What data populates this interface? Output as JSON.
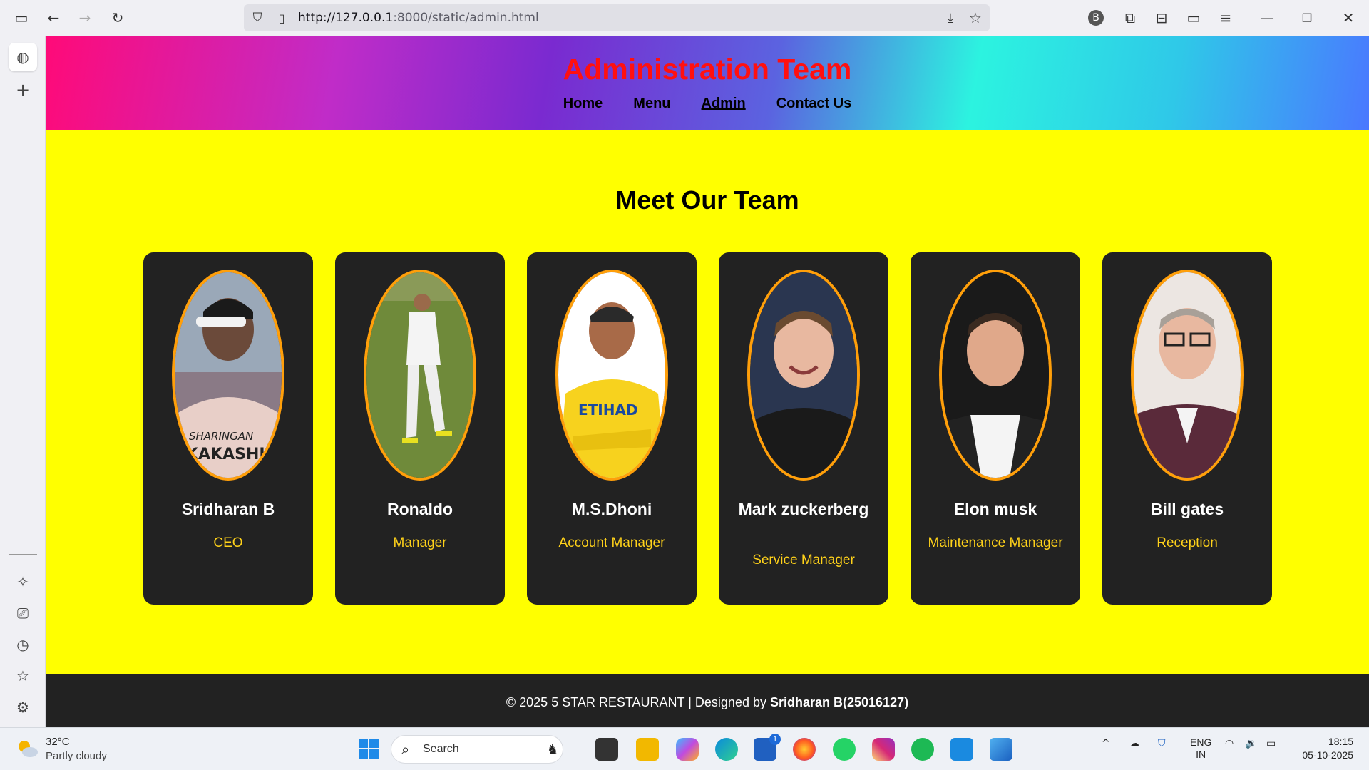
{
  "browser": {
    "url_host": "http://127.0.0.1",
    "url_rest": ":8000/static/admin.html"
  },
  "site": {
    "title": "Administration Team",
    "nav": [
      {
        "label": "Home"
      },
      {
        "label": "Menu"
      },
      {
        "label": "Admin",
        "active": true
      },
      {
        "label": "Contact Us"
      }
    ],
    "section_title": "Meet Our Team",
    "members": [
      {
        "name": "Sridharan B",
        "role": "CEO"
      },
      {
        "name": "Ronaldo",
        "role": "Manager"
      },
      {
        "name": "M.S.Dhoni",
        "role": "Account Manager"
      },
      {
        "name": "Mark zuckerberg",
        "role": "Service Manager"
      },
      {
        "name": "Elon musk",
        "role": "Maintenance Manager"
      },
      {
        "name": "Bill gates",
        "role": "Reception"
      }
    ],
    "footer": {
      "text": "© 2025 5 STAR RESTAURANT | Designed by ",
      "author": "Sridharan B(25016127)"
    }
  },
  "taskbar": {
    "weather_temp": "32°C",
    "weather_desc": "Partly cloudy",
    "search_placeholder": "Search",
    "lang_top": "ENG",
    "lang_bottom": "IN",
    "time": "18:15",
    "date": "05-10-2025",
    "store_badge": "1"
  },
  "colors": {
    "page_bg": "#ffff00",
    "title_red": "#ff1010",
    "card_bg": "#222222",
    "photo_border": "#ff9f0a",
    "role_yellow": "#ffd21a"
  }
}
